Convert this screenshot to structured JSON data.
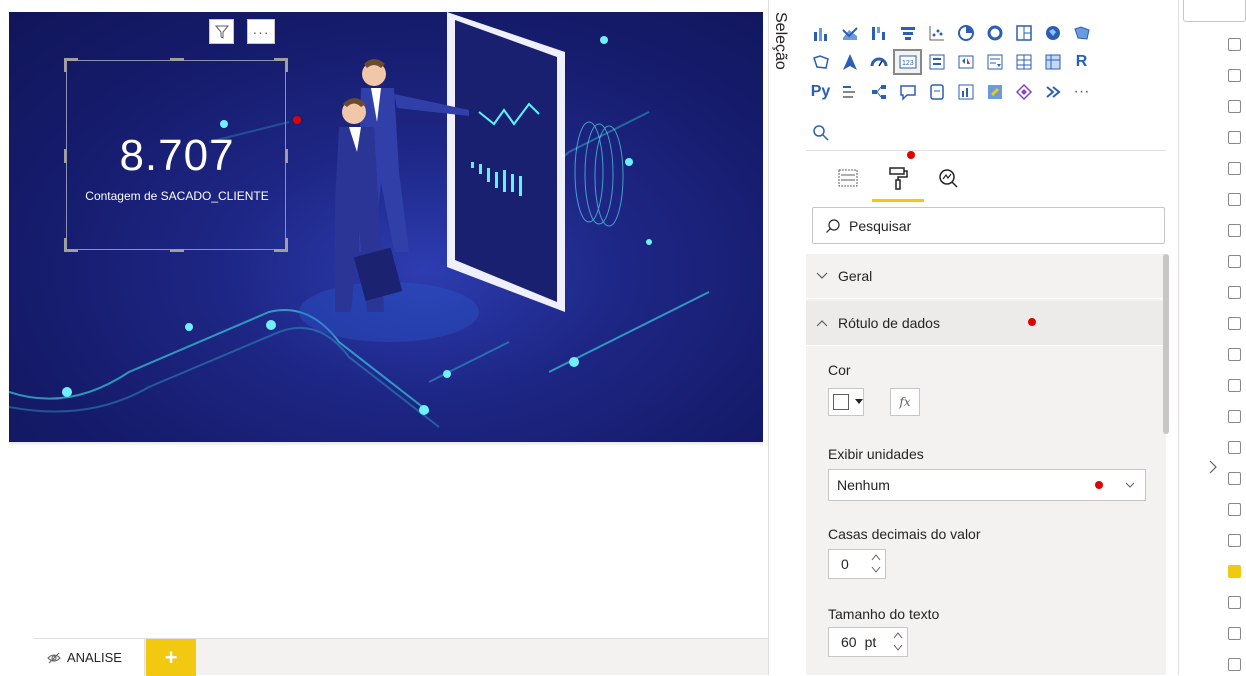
{
  "card": {
    "value": "8.707",
    "label": "Contagem de SACADO_CLIENTE"
  },
  "page_tabs": [
    {
      "label": "ANALISE"
    }
  ],
  "add_page_label": "+",
  "panes": {
    "selection_label": "Seleção"
  },
  "visualizations": {
    "row1": [
      "stacked-bar-icon",
      "ribbon-chart-icon",
      "waterfall-icon",
      "funnel-icon",
      "scatter-icon",
      "pie-icon",
      "donut-icon",
      "treemap-icon",
      "map-icon",
      "filled-map-icon"
    ],
    "row2": [
      "shape-map-icon",
      "azure-map-icon",
      "gauge-icon",
      "card-icon",
      "multirow-card-icon",
      "kpi-icon",
      "slicer-icon",
      "table-icon",
      "matrix-icon",
      "r-visual-icon"
    ],
    "row3": [
      "python-visual-icon",
      "key-influencers-icon",
      "decomposition-tree-icon",
      "qa-icon",
      "paginated-report-icon",
      "smart-narrative-icon",
      "powerapps-icon",
      "power-automate-icon",
      "power-automate-flow-icon",
      "more-icon"
    ],
    "r_label": "R",
    "py_label": "Py",
    "more_label": "···"
  },
  "format": {
    "search_placeholder": "Pesquisar",
    "sections": {
      "geral": "Geral",
      "rotulo": "Rótulo de dados"
    },
    "cor_label": "Cor",
    "fx_label": "fx",
    "exibir_unidades_label": "Exibir unidades",
    "exibir_unidades_value": "Nenhum",
    "casas_decimais_label": "Casas decimais do valor",
    "casas_decimais_value": "0",
    "tamanho_texto_label": "Tamanho do texto",
    "tamanho_texto_value": "60",
    "tamanho_texto_unit": "pt"
  },
  "fields": {
    "checkboxes": [
      false,
      false,
      false,
      false,
      false,
      false,
      false,
      false,
      false,
      false,
      false,
      false,
      false,
      false,
      false,
      false,
      false,
      true,
      false,
      false,
      false
    ]
  },
  "colors": {
    "accent": "#f2c811",
    "page_bg": "#1d2684",
    "viz_icon": "#2b5fb4",
    "marker": "#e00000"
  }
}
